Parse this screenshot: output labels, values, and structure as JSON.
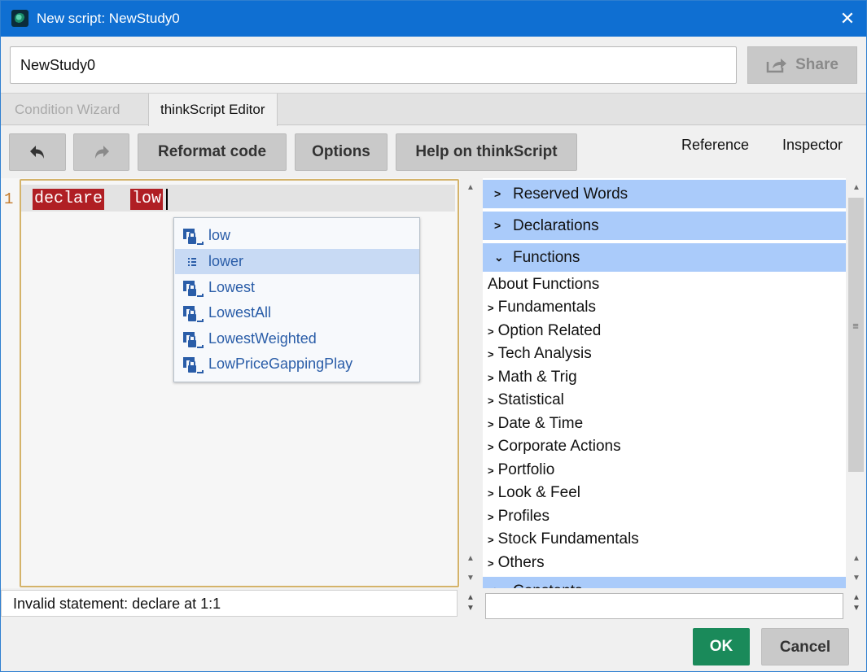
{
  "window": {
    "title": "New script: NewStudy0",
    "close_icon": "close-icon",
    "app_icon": "thinkorswim-icon"
  },
  "script_name": {
    "value": "NewStudy0"
  },
  "share": {
    "label": "Share",
    "icon": "share-icon"
  },
  "tabs": [
    {
      "label": "Condition Wizard",
      "active": false
    },
    {
      "label": "thinkScript Editor",
      "active": true
    }
  ],
  "toolbar": {
    "undo_icon": "undo-icon",
    "redo_icon": "redo-icon",
    "reformat_label": "Reformat code",
    "options_label": "Options",
    "help_label": "Help on thinkScript"
  },
  "panel_links": {
    "reference": "Reference",
    "inspector": "Inspector"
  },
  "editor": {
    "line_number": "1",
    "tokens": [
      "declare",
      "low"
    ]
  },
  "autocomplete": {
    "items": [
      {
        "label": "low",
        "icon": "function-lock-icon",
        "selected": false
      },
      {
        "label": "lower",
        "icon": "list-icon",
        "selected": true
      },
      {
        "label": "Lowest",
        "icon": "function-lock-icon",
        "selected": false
      },
      {
        "label": "LowestAll",
        "icon": "function-lock-icon",
        "selected": false
      },
      {
        "label": "LowestWeighted",
        "icon": "function-lock-icon",
        "selected": false
      },
      {
        "label": "LowPriceGappingPlay",
        "icon": "function-lock-icon",
        "selected": false
      }
    ]
  },
  "reference": {
    "sections": [
      {
        "label": "Reserved Words",
        "expanded": false
      },
      {
        "label": "Declarations",
        "expanded": false
      },
      {
        "label": "Functions",
        "expanded": true
      }
    ],
    "about": "About Functions",
    "nodes": [
      "Fundamentals",
      "Option Related",
      "Tech Analysis",
      "Math & Trig",
      "Statistical",
      "Date & Time",
      "Corporate Actions",
      "Portfolio",
      "Look & Feel",
      "Profiles",
      "Stock Fundamentals",
      "Others"
    ],
    "next_section": "Constants"
  },
  "status": {
    "message": "Invalid statement: declare at 1:1"
  },
  "buttons": {
    "ok": "OK",
    "cancel": "Cancel"
  },
  "colors": {
    "titlebar": "#0f6fd2",
    "ok": "#1a8a5a",
    "section": "#aacbfa",
    "error_highlight": "#b01f24",
    "selection": "#c8daf4"
  }
}
